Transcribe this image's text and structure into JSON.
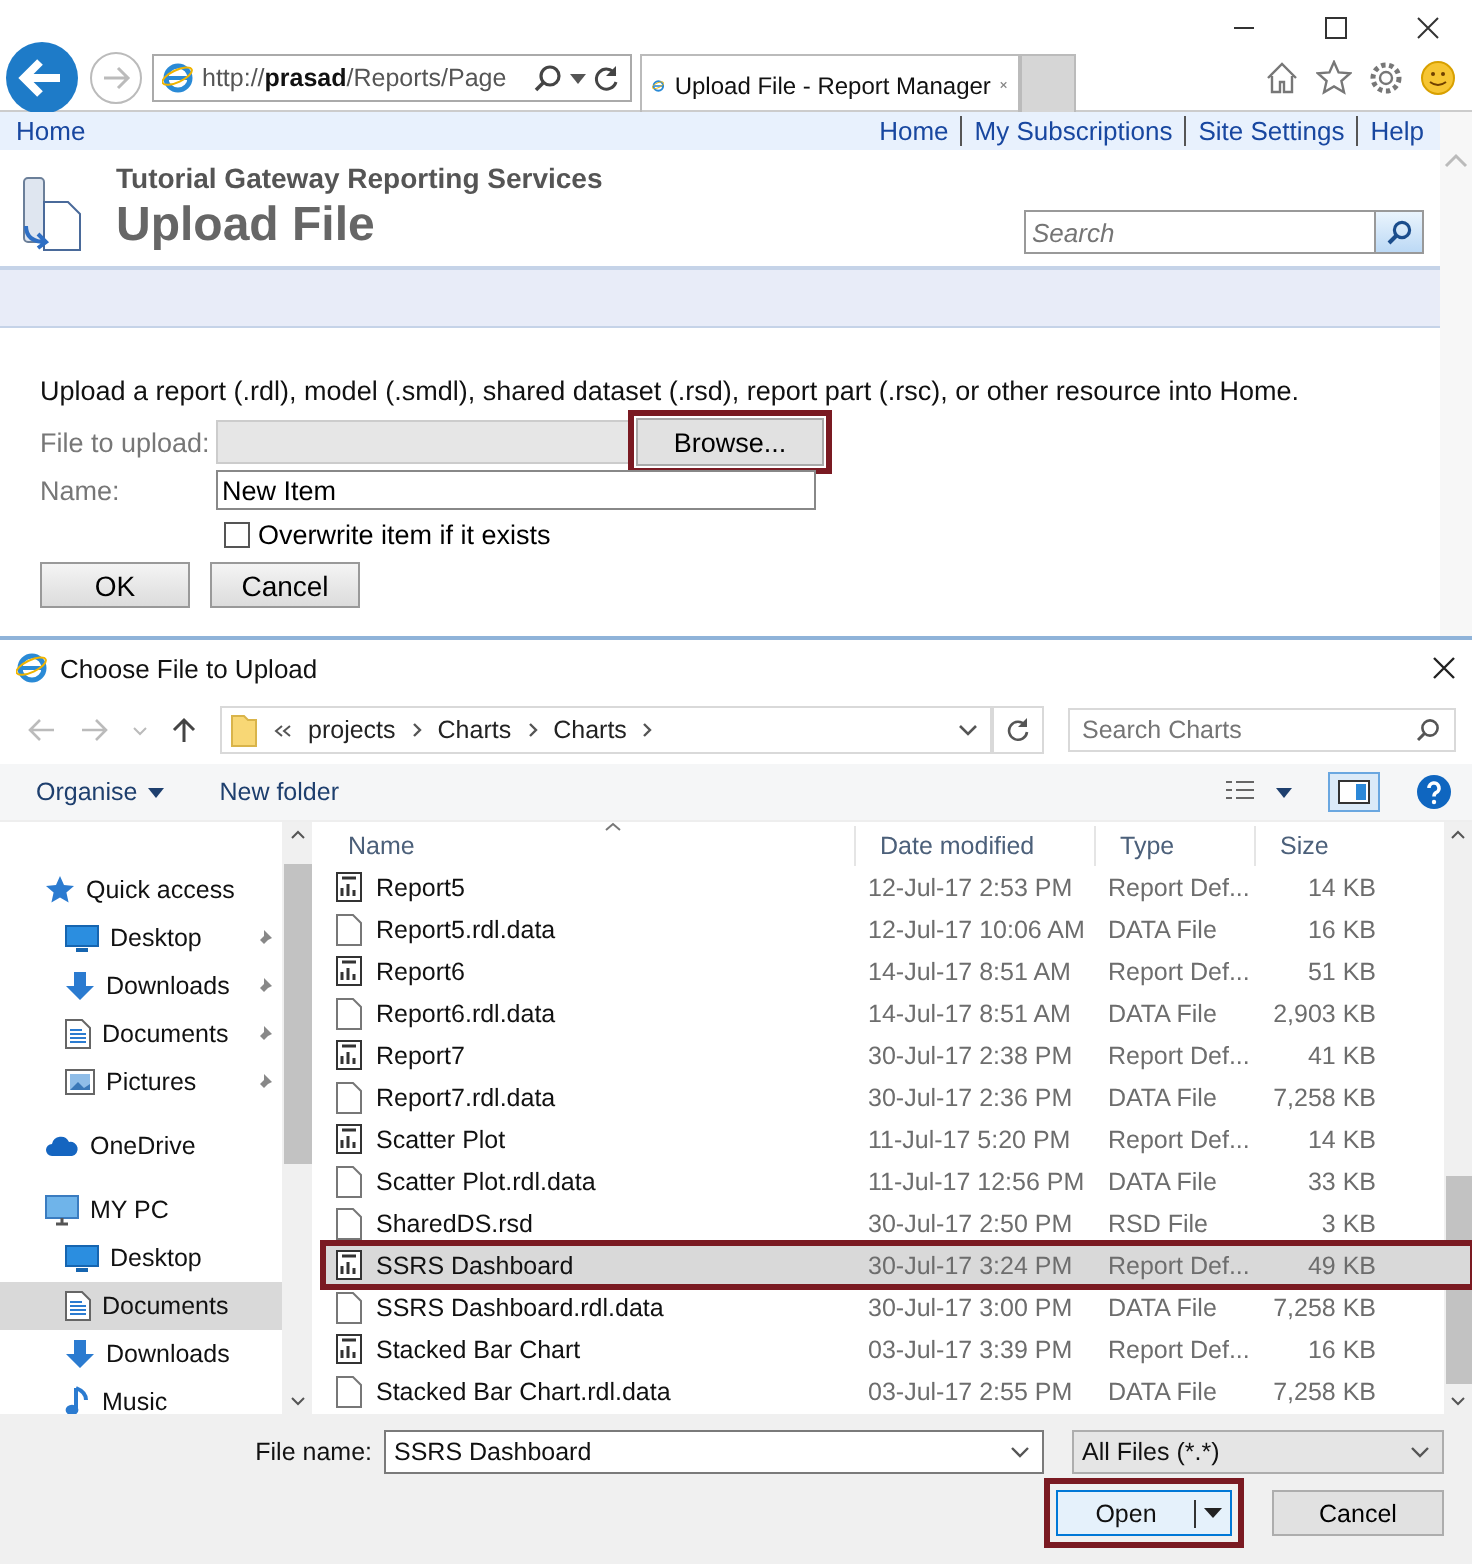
{
  "browser": {
    "address": "http://**prasad**/Reports/Page",
    "tab": "Upload File - Report Manager"
  },
  "page": {
    "breadcrumb": "Home",
    "links": [
      "Home",
      "My Subscriptions",
      "Site Settings",
      "Help"
    ],
    "site_title": "Tutorial Gateway Reporting Services",
    "page_title": "Upload File",
    "search": {
      "placeholder": "Search"
    }
  },
  "form": {
    "description": "Upload a report (.rdl), model (.smdl), shared dataset (.rsd), report part (.rsc), or other resource into Home.",
    "file_label": "File to upload:",
    "browse": {
      "label": "Browse...",
      "highlighted": true
    },
    "name_label": "Name:",
    "name_value": "New Item",
    "overwrite": {
      "label": "Overwrite item if it exists",
      "checked": false
    },
    "buttons": [
      "OK",
      "Cancel"
    ]
  },
  "dialog": {
    "title": "Choose File to Upload",
    "path": [
      "projects",
      "Charts",
      "Charts"
    ],
    "search": {
      "placeholder": "Search Charts"
    },
    "toolbar": [
      "Organise",
      "New folder"
    ],
    "nav": [
      {
        "label": "Quick access",
        "kind": "star",
        "selected": false,
        "children": [
          {
            "label": "Desktop",
            "kind": "desktop",
            "pinned": true,
            "selected": false
          },
          {
            "label": "Downloads",
            "kind": "download",
            "pinned": true,
            "selected": false
          },
          {
            "label": "Documents",
            "kind": "document",
            "pinned": true,
            "selected": false
          },
          {
            "label": "Pictures",
            "kind": "picture",
            "pinned": true,
            "selected": false
          }
        ]
      },
      {
        "label": "OneDrive",
        "kind": "cloud",
        "selected": false
      },
      {
        "label": "MY PC",
        "kind": "pc",
        "selected": false,
        "children": [
          {
            "label": "Desktop",
            "kind": "desktop",
            "pinned": false,
            "selected": false
          },
          {
            "label": "Documents",
            "kind": "document",
            "pinned": false,
            "selected": true
          },
          {
            "label": "Downloads",
            "kind": "download",
            "pinned": false,
            "selected": false
          },
          {
            "label": "Music",
            "kind": "music",
            "pinned": false,
            "selected": false
          }
        ]
      }
    ],
    "columns": [
      "Name",
      "Date modified",
      "Type",
      "Size"
    ],
    "rows": [
      {
        "name": "Report5",
        "date": "12-Jul-17 2:53 PM",
        "type": "Report Def...",
        "size": "14 KB",
        "kind": "report",
        "selected": false,
        "highlighted": false
      },
      {
        "name": "Report5.rdl.data",
        "date": "12-Jul-17 10:06 AM",
        "type": "DATA File",
        "size": "16 KB",
        "kind": "file",
        "selected": false,
        "highlighted": false
      },
      {
        "name": "Report6",
        "date": "14-Jul-17 8:51 AM",
        "type": "Report Def...",
        "size": "51 KB",
        "kind": "report",
        "selected": false,
        "highlighted": false
      },
      {
        "name": "Report6.rdl.data",
        "date": "14-Jul-17 8:51 AM",
        "type": "DATA File",
        "size": "2,903 KB",
        "kind": "file",
        "selected": false,
        "highlighted": false
      },
      {
        "name": "Report7",
        "date": "30-Jul-17 2:38 PM",
        "type": "Report Def...",
        "size": "41 KB",
        "kind": "report",
        "selected": false,
        "highlighted": false
      },
      {
        "name": "Report7.rdl.data",
        "date": "30-Jul-17 2:36 PM",
        "type": "DATA File",
        "size": "7,258 KB",
        "kind": "file",
        "selected": false,
        "highlighted": false
      },
      {
        "name": "Scatter Plot",
        "date": "11-Jul-17 5:20 PM",
        "type": "Report Def...",
        "size": "14 KB",
        "kind": "report",
        "selected": false,
        "highlighted": false
      },
      {
        "name": "Scatter Plot.rdl.data",
        "date": "11-Jul-17 12:56 PM",
        "type": "DATA File",
        "size": "33 KB",
        "kind": "file",
        "selected": false,
        "highlighted": false
      },
      {
        "name": "SharedDS.rsd",
        "date": "30-Jul-17 2:50 PM",
        "type": "RSD File",
        "size": "3 KB",
        "kind": "file",
        "selected": false,
        "highlighted": false
      },
      {
        "name": "SSRS Dashboard",
        "date": "30-Jul-17 3:24 PM",
        "type": "Report Def...",
        "size": "49 KB",
        "kind": "report",
        "selected": true,
        "highlighted": true
      },
      {
        "name": "SSRS Dashboard.rdl.data",
        "date": "30-Jul-17 3:00 PM",
        "type": "DATA File",
        "size": "7,258 KB",
        "kind": "file",
        "selected": false,
        "highlighted": false
      },
      {
        "name": "Stacked Bar Chart",
        "date": "03-Jul-17 3:39 PM",
        "type": "Report Def...",
        "size": "16 KB",
        "kind": "report",
        "selected": false,
        "highlighted": false
      },
      {
        "name": "Stacked Bar Chart.rdl.data",
        "date": "03-Jul-17 2:55 PM",
        "type": "DATA File",
        "size": "7,258 KB",
        "kind": "file",
        "selected": false,
        "highlighted": false
      }
    ],
    "file_name_label": "File name:",
    "file_name": "SSRS Dashboard",
    "filter": "All Files (*.*)",
    "open": {
      "label": "Open",
      "highlighted": true
    },
    "cancel": "Cancel"
  }
}
